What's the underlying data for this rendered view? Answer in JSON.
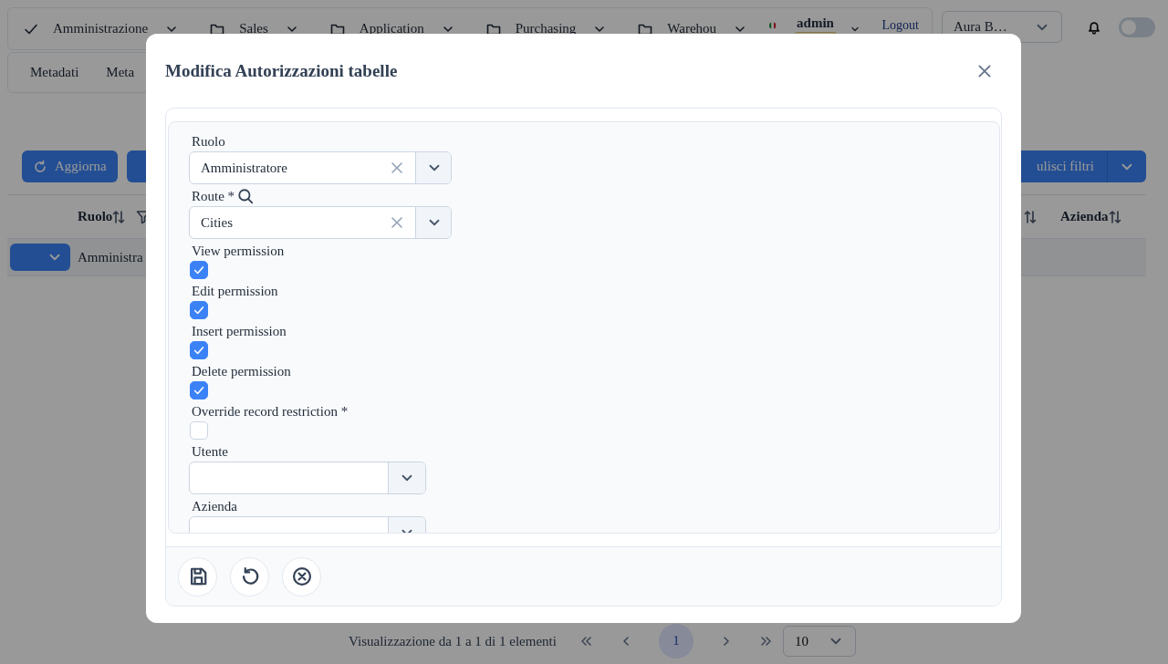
{
  "nav": {
    "menus": [
      {
        "label": "Amministrazione",
        "selected": true
      },
      {
        "label": "Sales",
        "selected": false
      },
      {
        "label": "Application",
        "selected": false
      },
      {
        "label": "Purchasing",
        "selected": false
      },
      {
        "label": "Warehou",
        "selected": false
      }
    ],
    "user": {
      "name": "admin"
    },
    "logout": "Logout",
    "company_select": {
      "value": "Aura B…"
    },
    "dark_mode": {
      "on": false
    }
  },
  "subnav": {
    "items": [
      "Metadati",
      "Meta"
    ]
  },
  "toolbar": {
    "refresh": "Aggiorna",
    "clear_filters": "ulisci filtri"
  },
  "table": {
    "columns": [
      {
        "label": "Ruolo",
        "filter": true
      },
      {
        "filter": false
      },
      {
        "label": "Azienda",
        "filter": false
      }
    ],
    "rows": [
      {
        "cells": [
          "Amministra"
        ]
      }
    ]
  },
  "pagination": {
    "summary": "Visualizzazione da 1 a 1 di 1 elementi",
    "pages": [
      {
        "label": "1",
        "selected": true
      }
    ],
    "page_size": "10"
  },
  "dialog": {
    "title": "Modifica Autorizzazioni tabelle",
    "fields": [
      {
        "kind": "select",
        "label": "Ruolo",
        "value": "Amministratore",
        "search": false
      },
      {
        "kind": "select",
        "label": "Route *",
        "value": "Cities",
        "search": true
      },
      {
        "kind": "checkbox",
        "label": "View permission",
        "checked": true
      },
      {
        "kind": "checkbox",
        "label": "Edit permission",
        "checked": true
      },
      {
        "kind": "checkbox",
        "label": "Insert permission",
        "checked": true
      },
      {
        "kind": "checkbox",
        "label": "Delete permission",
        "checked": true
      },
      {
        "kind": "checkbox",
        "label": "Override record restriction *",
        "checked": false
      },
      {
        "kind": "select",
        "label": "Utente",
        "search": false
      },
      {
        "kind": "select",
        "label": "Azienda",
        "search": false
      }
    ],
    "actions": [
      {
        "kind": "save"
      },
      {
        "kind": "undo"
      },
      {
        "kind": "cancel"
      }
    ]
  }
}
